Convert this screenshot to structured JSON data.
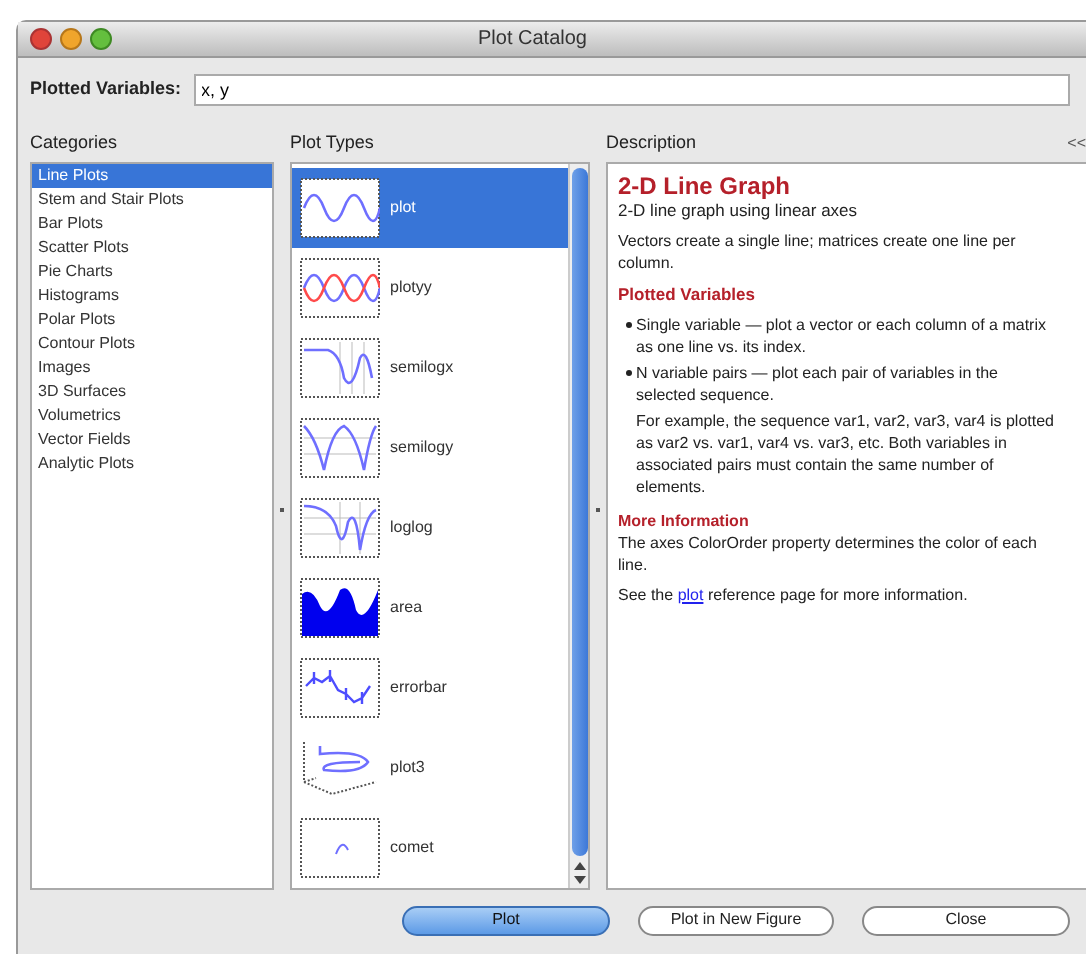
{
  "window": {
    "title": "Plot Catalog"
  },
  "plotted_variables": {
    "label": "Plotted Variables:",
    "value": "x, y"
  },
  "categories": {
    "heading": "Categories",
    "items": [
      {
        "label": "Line Plots",
        "selected": true
      },
      {
        "label": "Stem and Stair Plots",
        "selected": false
      },
      {
        "label": "Bar Plots",
        "selected": false
      },
      {
        "label": "Scatter Plots",
        "selected": false
      },
      {
        "label": "Pie Charts",
        "selected": false
      },
      {
        "label": "Histograms",
        "selected": false
      },
      {
        "label": "Polar Plots",
        "selected": false
      },
      {
        "label": "Contour Plots",
        "selected": false
      },
      {
        "label": "Images",
        "selected": false
      },
      {
        "label": "3D Surfaces",
        "selected": false
      },
      {
        "label": "Volumetrics",
        "selected": false
      },
      {
        "label": "Vector Fields",
        "selected": false
      },
      {
        "label": "Analytic Plots",
        "selected": false
      }
    ]
  },
  "plot_types": {
    "heading": "Plot Types",
    "items": [
      {
        "label": "plot",
        "selected": true
      },
      {
        "label": "plotyy",
        "selected": false
      },
      {
        "label": "semilogx",
        "selected": false
      },
      {
        "label": "semilogy",
        "selected": false
      },
      {
        "label": "loglog",
        "selected": false
      },
      {
        "label": "area",
        "selected": false
      },
      {
        "label": "errorbar",
        "selected": false
      },
      {
        "label": "plot3",
        "selected": false
      },
      {
        "label": "comet",
        "selected": false
      }
    ]
  },
  "description": {
    "heading": "Description",
    "collapse": "<<",
    "title": "2-D Line Graph",
    "subtitle": "2-D line graph using linear axes",
    "intro": "Vectors create a single line; matrices create one line per column.",
    "section_1": "Plotted Variables",
    "bullets": [
      "Single variable — plot a vector or each column of a matrix as one line vs. its index.",
      "N variable pairs — plot each pair of variables in the selected sequence."
    ],
    "example": "For example, the sequence var1, var2, var3, var4 is plotted as var2 vs. var1, var4 vs. var3, etc. Both variables in associated pairs must contain the same number of elements.",
    "section_2": "More Information",
    "more": "The axes ColorOrder property determines the color of each line.",
    "see_before": "See the",
    "see_link": "plot",
    "see_after": "reference page for more information."
  },
  "buttons": [
    {
      "label": "Plot",
      "default": true
    },
    {
      "label": "Plot in New Figure",
      "default": false
    },
    {
      "label": "Close",
      "default": false
    }
  ]
}
